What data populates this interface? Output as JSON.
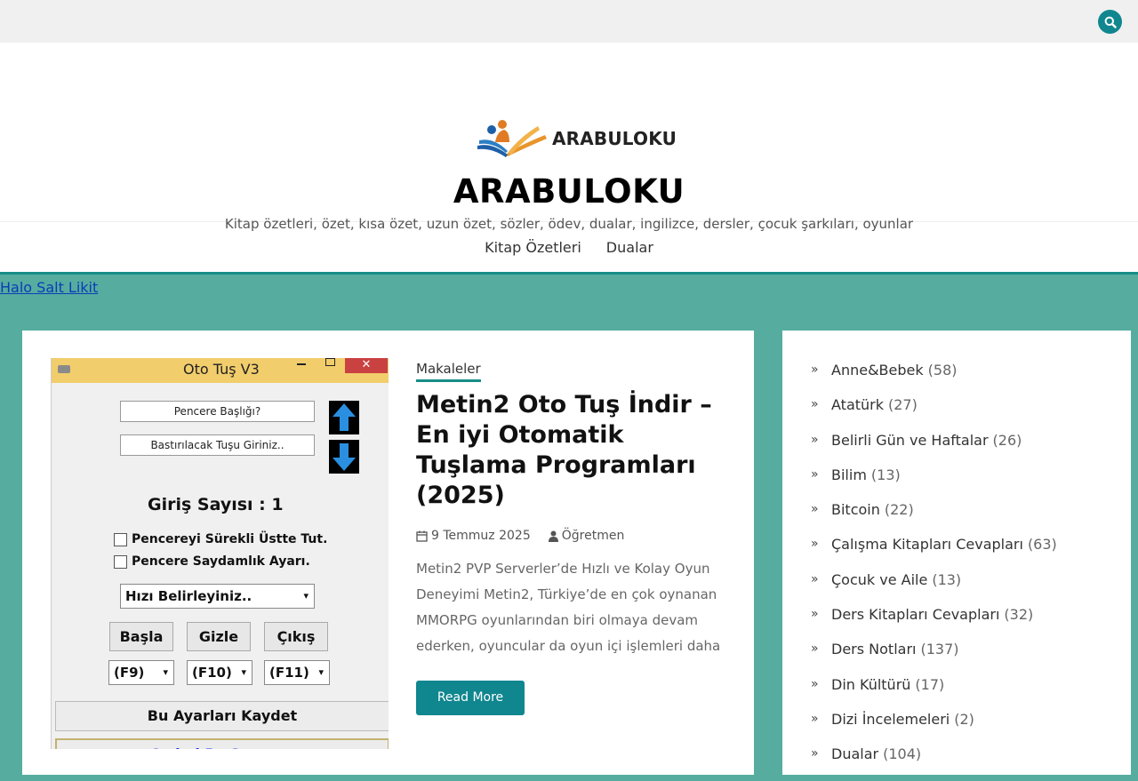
{
  "colors": {
    "accent": "#10868f",
    "background": "#56ad9f",
    "link": "#0b3cb8"
  },
  "header": {
    "logo_text": "ARABULOKU",
    "site_title": "ARABULOKU",
    "site_description": "Kitap özetleri, özet, kısa özet, uzun özet, sözler, ödev, dualar, ingilizce, dersler, çocuk şarkıları, oyunlar"
  },
  "nav": {
    "items": [
      "Kitap Özetleri",
      "Dualar"
    ]
  },
  "top_link": "Halo Salt Likit",
  "post": {
    "category": "Makaleler",
    "title": "Metin2 Oto Tuş İndir – En iyi Otomatik Tuşlama Programları (2025)",
    "date": "9 Temmuz 2025",
    "author": "Öğretmen",
    "excerpt": "Metin2 PVP Serverler’de Hızlı ve Kolay Oyun Deneyimi Metin2, Türkiye’de en çok oynanan MMORPG oyunlarından biri olmaya devam ederken, oyuncular da oyun içi işlemleri daha",
    "read_more": "Read More",
    "thumbnail": {
      "window_title": "Oto Tuş V3",
      "close_label": "✕",
      "field1": "Pencere Başlığı?",
      "field2": "Bastırılacak Tuşu Giriniz..",
      "giris": "Giriş Sayısı : 1",
      "check1": "Pencereyi Sürekli Üstte Tut.",
      "check2": "Pencere Saydamlık Ayarı.",
      "speed_select": "Hızı Belirleyiniz..",
      "btn_start": "Başla",
      "btn_hide": "Gizle",
      "btn_exit": "Çıkış",
      "key1": "(F9)",
      "key2": "(F10)",
      "key3": "(F11)",
      "save": "Bu Ayarları Kaydet",
      "coded": "Coded By Scrappy"
    }
  },
  "sidebar": {
    "categories": [
      {
        "name": "Anne&Bebek",
        "count": "(58)"
      },
      {
        "name": "Atatürk",
        "count": "(27)"
      },
      {
        "name": "Belirli Gün ve Haftalar",
        "count": "(26)"
      },
      {
        "name": "Bilim",
        "count": "(13)"
      },
      {
        "name": "Bitcoin",
        "count": "(22)"
      },
      {
        "name": "Çalışma Kitapları Cevapları",
        "count": "(63)"
      },
      {
        "name": "Çocuk ve Aile",
        "count": "(13)"
      },
      {
        "name": "Ders Kitapları Cevapları",
        "count": "(32)"
      },
      {
        "name": "Ders Notları",
        "count": "(137)"
      },
      {
        "name": "Din Kültürü",
        "count": "(17)"
      },
      {
        "name": "Dizi İncelemeleri",
        "count": "(2)"
      },
      {
        "name": "Dualar",
        "count": "(104)"
      }
    ]
  }
}
